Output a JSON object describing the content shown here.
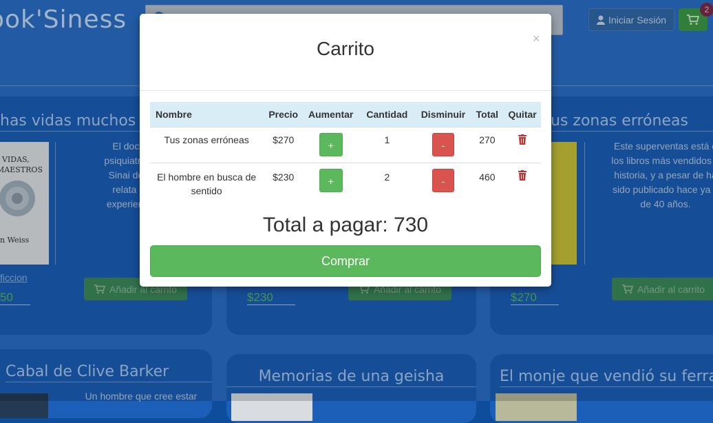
{
  "header": {
    "brand": "ook'Siness",
    "login_label": "Iniciar Sesión",
    "cart_count": "2"
  },
  "cards": [
    {
      "title": "has vidas muchos m",
      "description": "El doctor Br\npsiquiatra del H\nSinai de Mian\nrelata en es\nexperiencia co",
      "category": "ficcion",
      "price": "50",
      "add_label": "Añadir al carrito",
      "cover_text": "AS VIDAS,\nS MAESTROS\nn Weiss"
    },
    {
      "title": "",
      "price": "$230",
      "add_label": "Añadir al carrito"
    },
    {
      "title": "us zonas erróneas",
      "description": "Este superventas está e\nlos libros más vendidos d\nhistoria, y a pesar de ha\nsido publicado hace ya n\nde 40 años.",
      "price": "$270",
      "add_label": "Añadir al carrito"
    },
    {
      "title": "Cabal de Clive Barker",
      "description": "Un hombre que cree estar"
    },
    {
      "title": "Memorias de una geisha"
    },
    {
      "title": "El monje que vendió su ferra"
    }
  ],
  "modal": {
    "title": "Carrito",
    "close_label": "×",
    "columns": [
      "Nombre",
      "Precio",
      "Aumentar",
      "Cantidad",
      "Disminuir",
      "Total",
      "Quitar"
    ],
    "rows": [
      {
        "name": "Tus zonas erróneas",
        "price": "$270",
        "plus": "+",
        "quantity": "1",
        "minus": "-",
        "total": "270"
      },
      {
        "name": "El hombre en busca de sentido",
        "price": "$230",
        "plus": "+",
        "quantity": "2",
        "minus": "-",
        "total": "460"
      }
    ],
    "total_label": "Total a pagar: 730",
    "buy_label": "Comprar"
  },
  "colors": {
    "background": "#2a6fc8",
    "card": "#1b5fb9",
    "success": "#5cb85c",
    "danger": "#d9534f",
    "table_header": "#d9edf7",
    "trash": "#c9302c"
  },
  "icons": {
    "user": "user-icon",
    "cart": "cart-icon",
    "trash": "trash-icon",
    "close": "close-icon"
  }
}
